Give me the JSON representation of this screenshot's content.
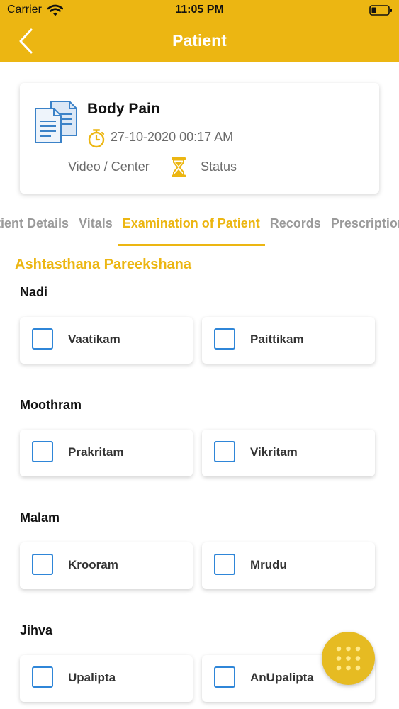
{
  "status_bar": {
    "carrier": "Carrier",
    "time": "11:05 PM"
  },
  "nav": {
    "title": "Patient",
    "back_icon": "chevron-left-icon"
  },
  "appointment": {
    "title": "Body Pain",
    "datetime": "27-10-2020 00:17 AM",
    "mode": "Video / Center",
    "status": "Status"
  },
  "tabs": [
    {
      "label": "Patient Details",
      "active": false
    },
    {
      "label": "Vitals",
      "active": false
    },
    {
      "label": "Examination of Patient",
      "active": true
    },
    {
      "label": "Records",
      "active": false
    },
    {
      "label": "Prescription",
      "active": false
    }
  ],
  "section": {
    "title": "Ashtasthana Pareekshana"
  },
  "groups": [
    {
      "label": "Nadi",
      "options": [
        {
          "label": "Vaatikam",
          "checked": false
        },
        {
          "label": "Paittikam",
          "checked": false
        }
      ]
    },
    {
      "label": "Moothram",
      "options": [
        {
          "label": "Prakritam",
          "checked": false
        },
        {
          "label": "Vikritam",
          "checked": false
        }
      ]
    },
    {
      "label": "Malam",
      "options": [
        {
          "label": "Krooram",
          "checked": false
        },
        {
          "label": "Mrudu",
          "checked": false
        }
      ]
    },
    {
      "label": "Jihva",
      "options": [
        {
          "label": "Upalipta",
          "checked": false
        },
        {
          "label": "AnUpalipta",
          "checked": false
        }
      ]
    }
  ],
  "colors": {
    "accent": "#ecb612",
    "checkbox_border": "#2f86d8",
    "fab": "#e6bb22"
  }
}
